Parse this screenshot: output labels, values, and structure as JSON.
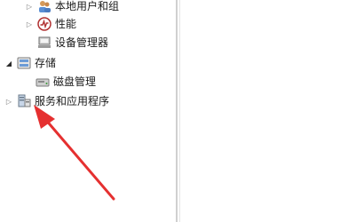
{
  "tree": {
    "items": [
      {
        "label": "本地用户和组",
        "icon": "users-groups-icon",
        "expander": "collapsed"
      },
      {
        "label": "性能",
        "icon": "performance-icon",
        "expander": "collapsed"
      },
      {
        "label": "设备管理器",
        "icon": "device-manager-icon",
        "expander": "none"
      },
      {
        "label": "存储",
        "icon": "storage-icon",
        "expander": "expanded"
      },
      {
        "label": "磁盘管理",
        "icon": "disk-management-icon",
        "expander": "none"
      },
      {
        "label": "服务和应用程序",
        "icon": "services-apps-icon",
        "expander": "collapsed"
      }
    ]
  },
  "annotation": {
    "type": "red-arrow",
    "color": "#e53030",
    "points_to": "服务和应用程序"
  }
}
